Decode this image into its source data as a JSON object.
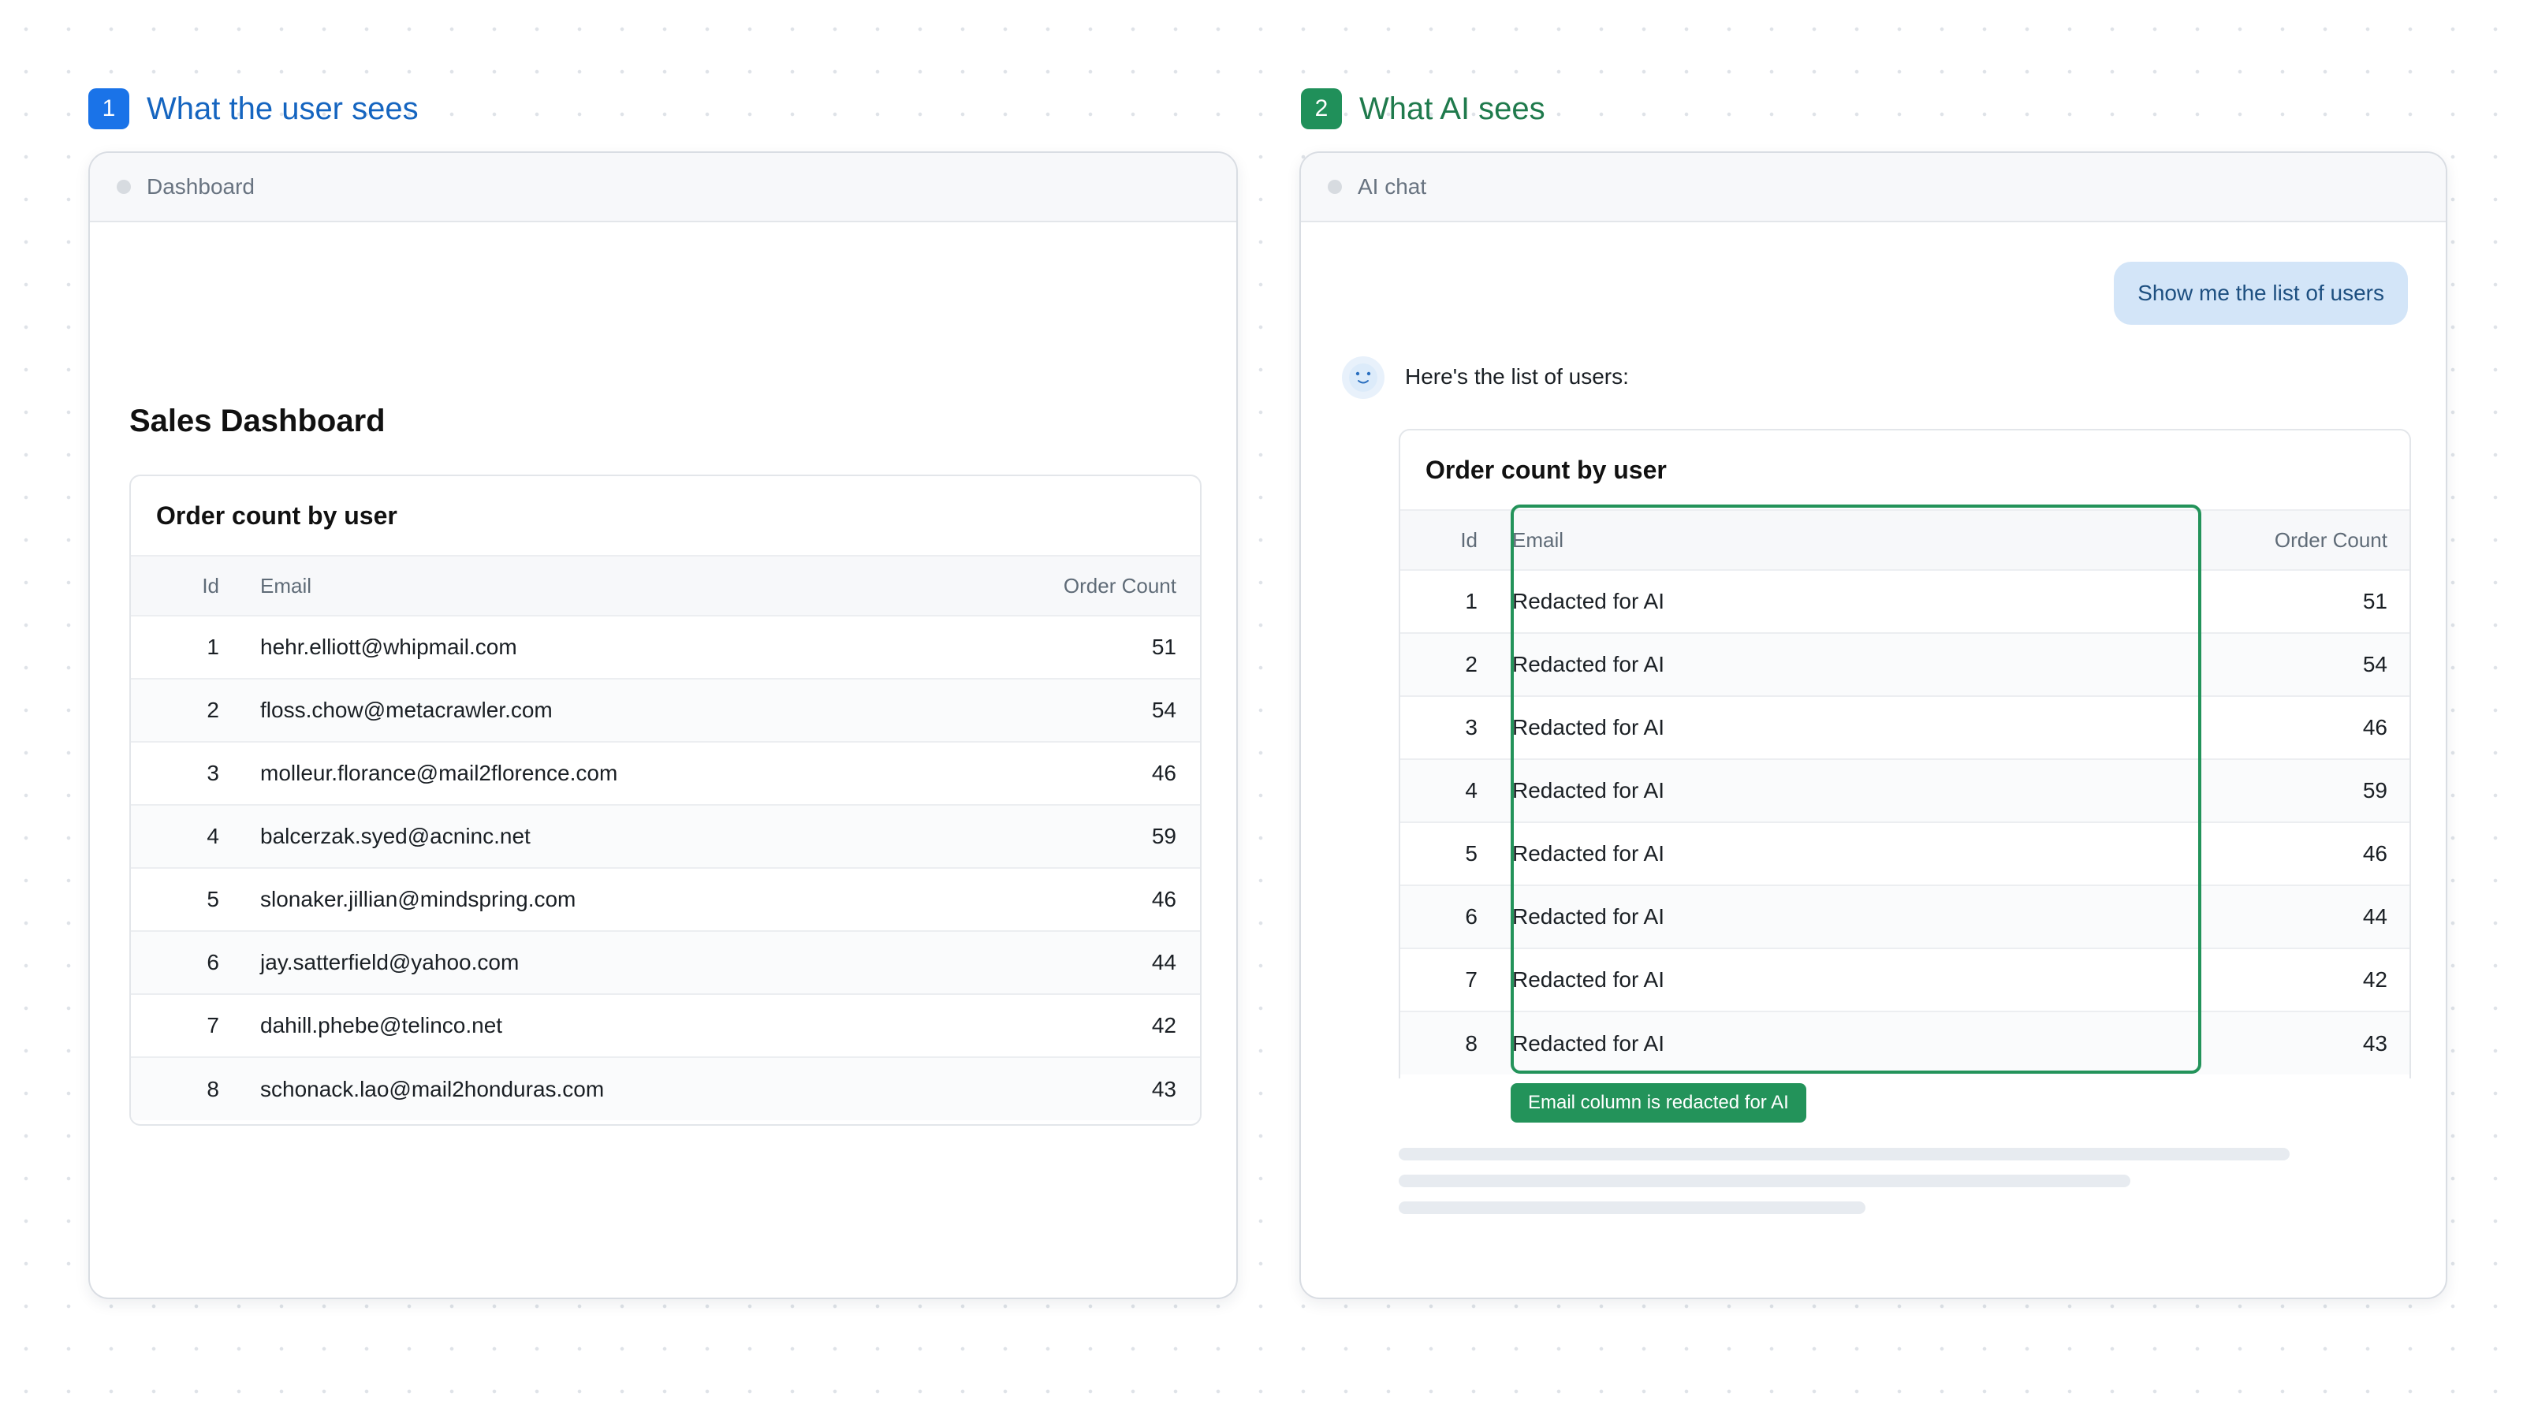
{
  "left_section": {
    "step": "1",
    "title": "What the user sees"
  },
  "right_section": {
    "step": "2",
    "title": "What AI sees"
  },
  "colors": {
    "blue_accent": "#1a73e8",
    "green_accent": "#20905a",
    "redact_green": "#23935a",
    "bubble_blue": "#d3e5f8"
  },
  "dashboard": {
    "window_title": "Dashboard",
    "page_title": "Sales Dashboard",
    "card_title": "Order count by user",
    "columns": [
      "Id",
      "Email",
      "Order Count"
    ],
    "rows": [
      {
        "id": "1",
        "email": "hehr.elliott@whipmail.com",
        "count": "51"
      },
      {
        "id": "2",
        "email": "floss.chow@metacrawler.com",
        "count": "54"
      },
      {
        "id": "3",
        "email": "molleur.florance@mail2florence.com",
        "count": "46"
      },
      {
        "id": "4",
        "email": "balcerzak.syed@acninc.net",
        "count": "59"
      },
      {
        "id": "5",
        "email": "slonaker.jillian@mindspring.com",
        "count": "46"
      },
      {
        "id": "6",
        "email": "jay.satterfield@yahoo.com",
        "count": "44"
      },
      {
        "id": "7",
        "email": "dahill.phebe@telinco.net",
        "count": "42"
      },
      {
        "id": "8",
        "email": "schonack.lao@mail2honduras.com",
        "count": "43"
      }
    ]
  },
  "ai_chat": {
    "window_title": "AI chat",
    "user_message": "Show me the list of users",
    "ai_message": "Here's the list of users:",
    "avatar_icon": "bot-face-icon",
    "card_title": "Order count by user",
    "columns": [
      "Id",
      "Email",
      "Order Count"
    ],
    "rows": [
      {
        "id": "1",
        "email": "Redacted for AI",
        "count": "51"
      },
      {
        "id": "2",
        "email": "Redacted for AI",
        "count": "54"
      },
      {
        "id": "3",
        "email": "Redacted for AI",
        "count": "46"
      },
      {
        "id": "4",
        "email": "Redacted for AI",
        "count": "59"
      },
      {
        "id": "5",
        "email": "Redacted for AI",
        "count": "46"
      },
      {
        "id": "6",
        "email": "Redacted for AI",
        "count": "44"
      },
      {
        "id": "7",
        "email": "Redacted for AI",
        "count": "42"
      },
      {
        "id": "8",
        "email": "Redacted for AI",
        "count": "43"
      }
    ],
    "redaction_badge": "Email column is redacted for AI"
  }
}
